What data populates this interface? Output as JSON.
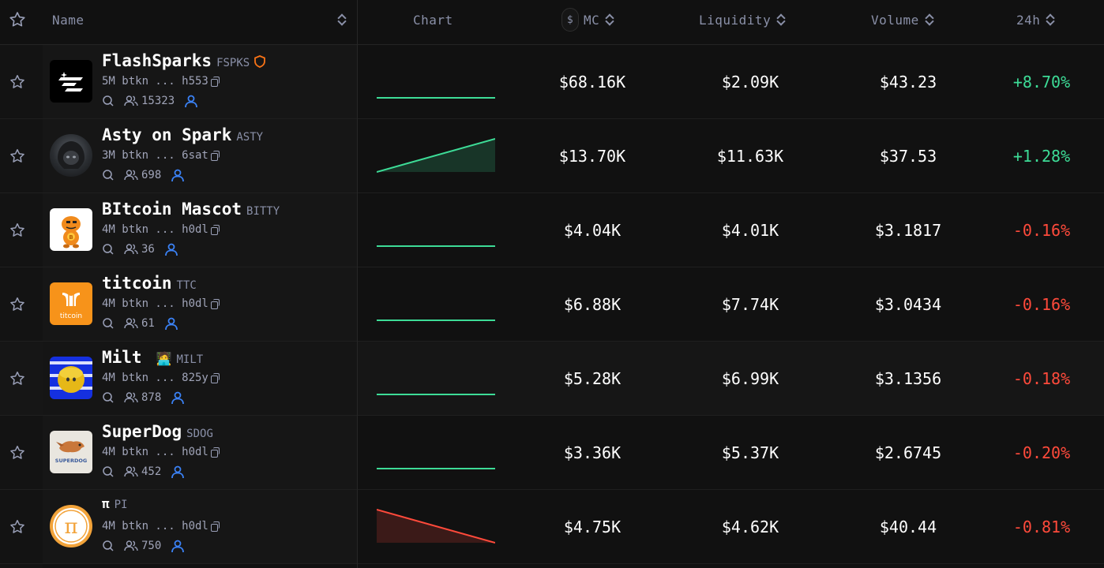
{
  "header": {
    "name": "Name",
    "chart": "Chart",
    "currency_toggle": "$",
    "mc": "MC",
    "liquidity": "Liquidity",
    "volume": "Volume",
    "change": "24h"
  },
  "colors": {
    "up": "#3ddc97",
    "down": "#ff4a3b",
    "holder_icon": "#3b82f6",
    "badge": "#f97316"
  },
  "rows": [
    {
      "name": "FlashSparks",
      "ticker": "FSPKS",
      "sub": "5M btkn ... h553",
      "holders": "15323",
      "mc": "$68.16K",
      "liquidity": "$2.09K",
      "volume": "$43.23",
      "change": "+8.70%",
      "trend": "flat",
      "logo": "flashsparks-logo",
      "badge": "shield-icon"
    },
    {
      "name": "Asty on Spark",
      "ticker": "ASTY",
      "sub": "3M btkn ... 6sat",
      "holders": "698",
      "mc": "$13.70K",
      "liquidity": "$11.63K",
      "volume": "$37.53",
      "change": "+1.28%",
      "trend": "up",
      "logo": "asty-logo"
    },
    {
      "name": "BItcoin Mascot",
      "ticker": "BITTY",
      "sub": "4M btkn ... h0dl",
      "holders": "36",
      "mc": "$4.04K",
      "liquidity": "$4.01K",
      "volume": "$3.1817",
      "change": "-0.16%",
      "trend": "flat",
      "logo": "bitty-mascot-logo"
    },
    {
      "name": "titcoin",
      "ticker": "TTC",
      "sub": "4M btkn ... h0dl",
      "holders": "61",
      "mc": "$6.88K",
      "liquidity": "$7.74K",
      "volume": "$3.0434",
      "change": "-0.16%",
      "trend": "flat",
      "logo": "titcoin-logo",
      "logo_text": "titcoin"
    },
    {
      "name": "Milt",
      "ticker": "MILT",
      "sub": "4M btkn ... 825y",
      "holders": "878",
      "mc": "$5.28K",
      "liquidity": "$6.99K",
      "volume": "$3.1356",
      "change": "-0.18%",
      "trend": "flat",
      "logo": "milt-logo",
      "emoji": "🧑‍💻"
    },
    {
      "name": "SuperDog",
      "ticker": "SDOG",
      "sub": "4M btkn ... h0dl",
      "holders": "452",
      "mc": "$3.36K",
      "liquidity": "$5.37K",
      "volume": "$2.6745",
      "change": "-0.20%",
      "trend": "flat",
      "logo": "superdog-logo",
      "logo_text": "SUPERDOG"
    },
    {
      "name": "π",
      "ticker": "PI",
      "sub": "4M btkn ... h0dl",
      "holders": "750",
      "mc": "$4.75K",
      "liquidity": "$4.62K",
      "volume": "$40.44",
      "change": "-0.81%",
      "trend": "down",
      "logo": "pi-logo",
      "logo_text": "π"
    }
  ]
}
